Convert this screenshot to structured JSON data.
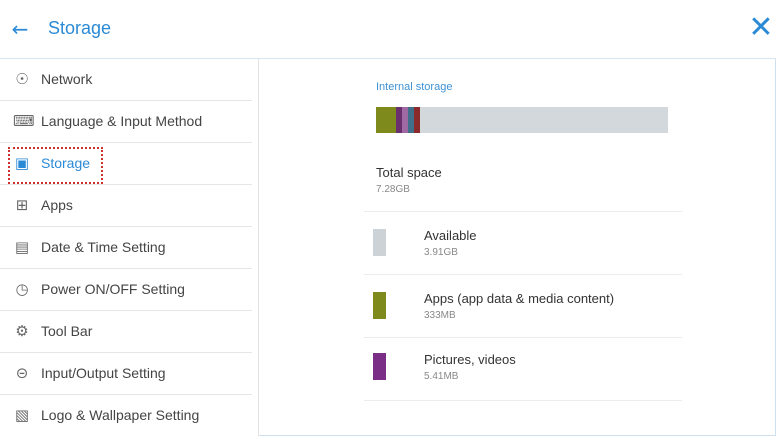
{
  "header": {
    "title": "Storage"
  },
  "sidebar": {
    "items": [
      {
        "label": "Network",
        "icon": "globe-icon",
        "glyph": "☉"
      },
      {
        "label": "Language & Input Method",
        "icon": "keyboard-icon",
        "glyph": "⌨"
      },
      {
        "label": "Storage",
        "icon": "floppy-disk-icon",
        "glyph": "▣",
        "active": true
      },
      {
        "label": "Apps",
        "icon": "apps-grid-icon",
        "glyph": "⊞"
      },
      {
        "label": "Date & Time Setting",
        "icon": "calendar-icon",
        "glyph": "▤"
      },
      {
        "label": "Power ON/OFF Setting",
        "icon": "power-timer-icon",
        "glyph": "◷"
      },
      {
        "label": "Tool Bar",
        "icon": "tool-gear-icon",
        "glyph": "⚙"
      },
      {
        "label": "Input/Output Setting",
        "icon": "input-output-icon",
        "glyph": "⊝"
      },
      {
        "label": "Logo & Wallpaper Setting",
        "icon": "image-icon",
        "glyph": "▧"
      }
    ]
  },
  "storage": {
    "section_title": "Internal storage",
    "bar_segments": [
      {
        "color": "#7f8a1c",
        "fraction": 0.07
      },
      {
        "color": "#6a2f6e",
        "fraction": 0.02
      },
      {
        "color": "#9f6aa3",
        "fraction": 0.02
      },
      {
        "color": "#3f6f8a",
        "fraction": 0.02
      },
      {
        "color": "#8b2a2a",
        "fraction": 0.02
      }
    ],
    "bar_track_color": "#d3d8dc",
    "total": {
      "label": "Total space",
      "value": "7.28GB"
    },
    "rows": [
      {
        "label": "Available",
        "value": "3.91GB",
        "color": "#ccd2d6"
      },
      {
        "label": "Apps (app data & media content)",
        "value": "333MB",
        "color": "#7f8a1c"
      },
      {
        "label": "Pictures, videos",
        "value": "5.41MB",
        "color": "#7a2e86"
      }
    ]
  }
}
